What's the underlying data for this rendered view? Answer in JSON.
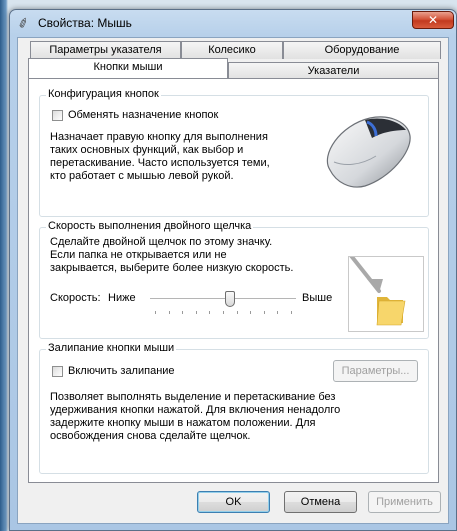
{
  "window": {
    "title": "Свойства: Мышь",
    "close_label": "✕"
  },
  "tabs": {
    "row_back": [
      "Параметры указателя",
      "Колесико",
      "Оборудование"
    ],
    "row_front": [
      "Кнопки мыши",
      "Указатели"
    ],
    "active": "Кнопки мыши"
  },
  "button_config": {
    "legend": "Конфигурация кнопок",
    "checkbox_label": "Обменять назначение кнопок",
    "checked": false,
    "description": [
      "Назначает правую кнопку для выполнения",
      "таких основных функций, как выбор и",
      "перетаскивание. Часто используется теми,",
      "кто работает с мышью левой рукой."
    ]
  },
  "double_click": {
    "legend": "Скорость выполнения двойного щелчка",
    "description": [
      "Сделайте двойной щелчок по этому значку.",
      "Если папка не открывается или не",
      "закрывается, выберите более низкую скорость."
    ],
    "speed_label": "Скорость:",
    "slow_label": "Ниже",
    "fast_label": "Выше",
    "speed_value": 0.55
  },
  "click_lock": {
    "legend": "Залипание кнопки мыши",
    "checkbox_label": "Включить залипание",
    "checked": false,
    "settings_button": "Параметры...",
    "description": [
      "Позволяет выполнять выделение и перетаскивание без",
      "удерживания кнопки нажатой. Для включения ненадолго",
      "задержите кнопку мыши в нажатом положении. Для",
      "освобождения снова сделайте щелчок."
    ]
  },
  "footer": {
    "ok": "OK",
    "cancel": "Отмена",
    "apply": "Применить"
  }
}
